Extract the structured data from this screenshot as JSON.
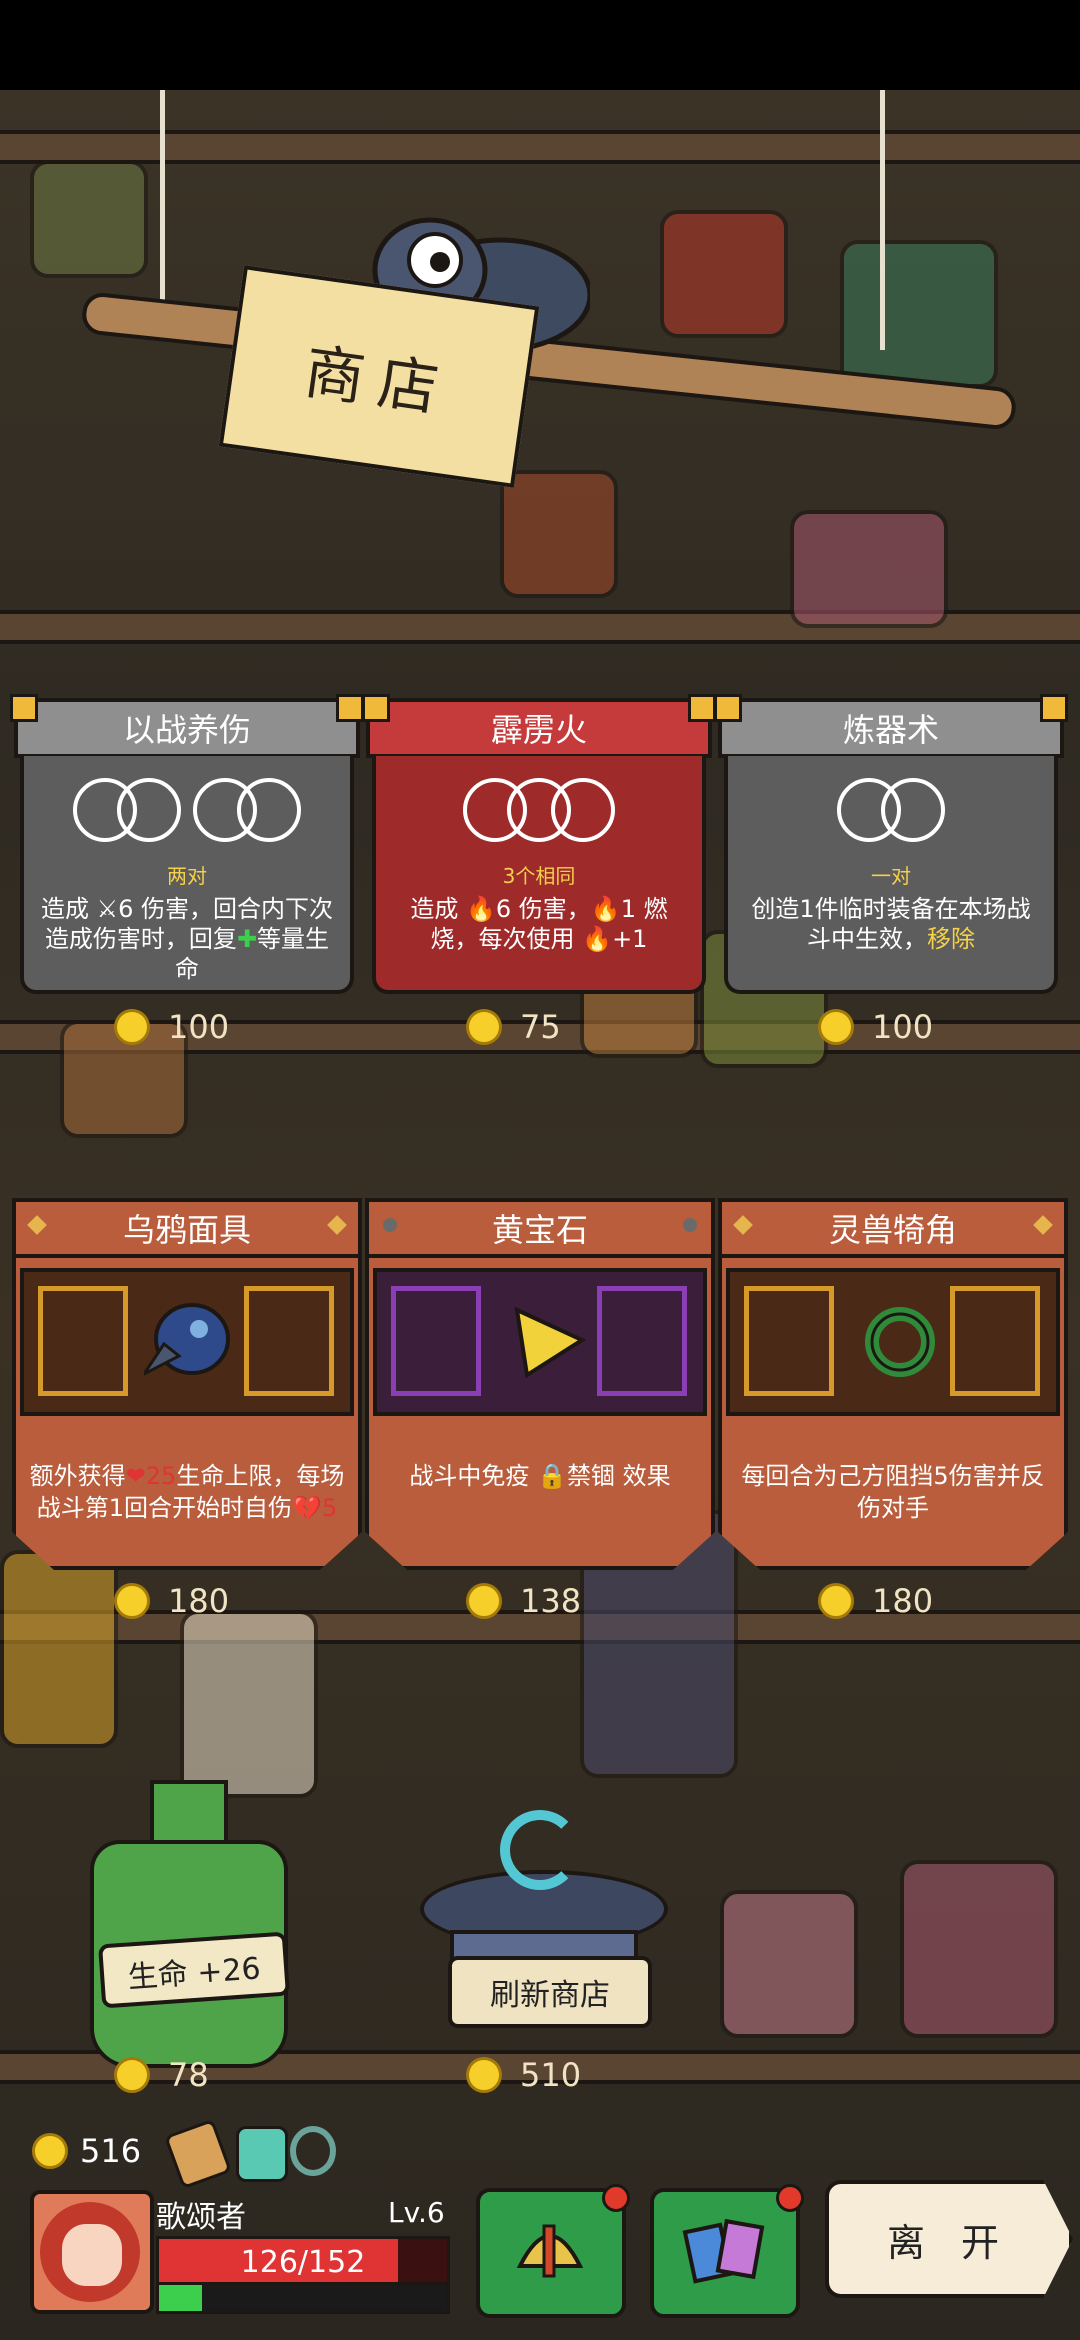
{
  "shop": {
    "title": "商店"
  },
  "skills": [
    {
      "name": "以战养伤",
      "requirement": "两对",
      "desc_prefix": "造成",
      "desc_rest": "6 伤害，回合内下次造成伤害时，回复",
      "desc_suffix": "等量生命",
      "price": "100",
      "style": "gray"
    },
    {
      "name": "霹雳火",
      "requirement": "3个相同",
      "desc_prefix": "造成",
      "desc_rest": "6 伤害，",
      "desc_burn": "1 燃烧，每次使用",
      "desc_suffix": "+1",
      "price": "75",
      "style": "red"
    },
    {
      "name": "炼器术",
      "requirement": "一对",
      "desc_prefix": "创造1件临时装备在本场战斗中生效，",
      "desc_highlight": "移除",
      "price": "100",
      "style": "gray"
    }
  ],
  "items": [
    {
      "name": "乌鸦面具",
      "desc_a": "额外获得",
      "desc_num1": "25",
      "desc_b": "生命上限，每场战斗第1回合开始时自伤",
      "desc_num2": "5",
      "price": "180"
    },
    {
      "name": "黄宝石",
      "desc_a": "战斗中免疫",
      "desc_b": "禁锢 效果",
      "price": "138"
    },
    {
      "name": "灵兽犄角",
      "desc_a": "每回合为己方阻挡5伤害并反伤对手",
      "price": "180"
    }
  ],
  "potion": {
    "label": "生命 +26",
    "price": "78"
  },
  "refresh": {
    "label": "刷新商店",
    "price": "510"
  },
  "leave_label": "离 开",
  "player": {
    "gold": "516",
    "name": "歌颂者",
    "level": "Lv.6",
    "hp_text": "126/152",
    "hp_fraction": 0.83,
    "xp_fraction": 0.15
  },
  "colors": {
    "coin": "#f6cf2a",
    "hp": "#e03434",
    "xp": "#3ccf4d",
    "highlight": "#f3d14a"
  }
}
